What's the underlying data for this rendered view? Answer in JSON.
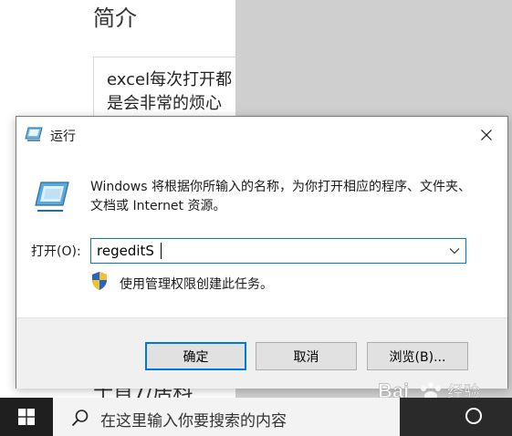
{
  "background": {
    "title": "简介",
    "line1": "excel每次打开都",
    "line2": "是会非常的烦心",
    "bottom_text": "十首7/居料"
  },
  "dialog": {
    "title": "运行",
    "description": "Windows 将根据你所输入的名称，为你打开相应的程序、文件夹、文档或 Internet 资源。",
    "open_label": "打开(O):",
    "command_value": "regeditS",
    "admin_note": "使用管理权限创建此任务。",
    "buttons": {
      "ok": "确定",
      "cancel": "取消",
      "browse": "浏览(B)..."
    }
  },
  "taskbar": {
    "search_placeholder": "在这里输入你要搜索的内容"
  },
  "watermark": {
    "text": "Bai 经验",
    "url": "jingyan.baidu.com"
  },
  "colors": {
    "accent": "#0078d7",
    "taskbar": "#1f1f1f",
    "footer": "#f0f0f0"
  }
}
